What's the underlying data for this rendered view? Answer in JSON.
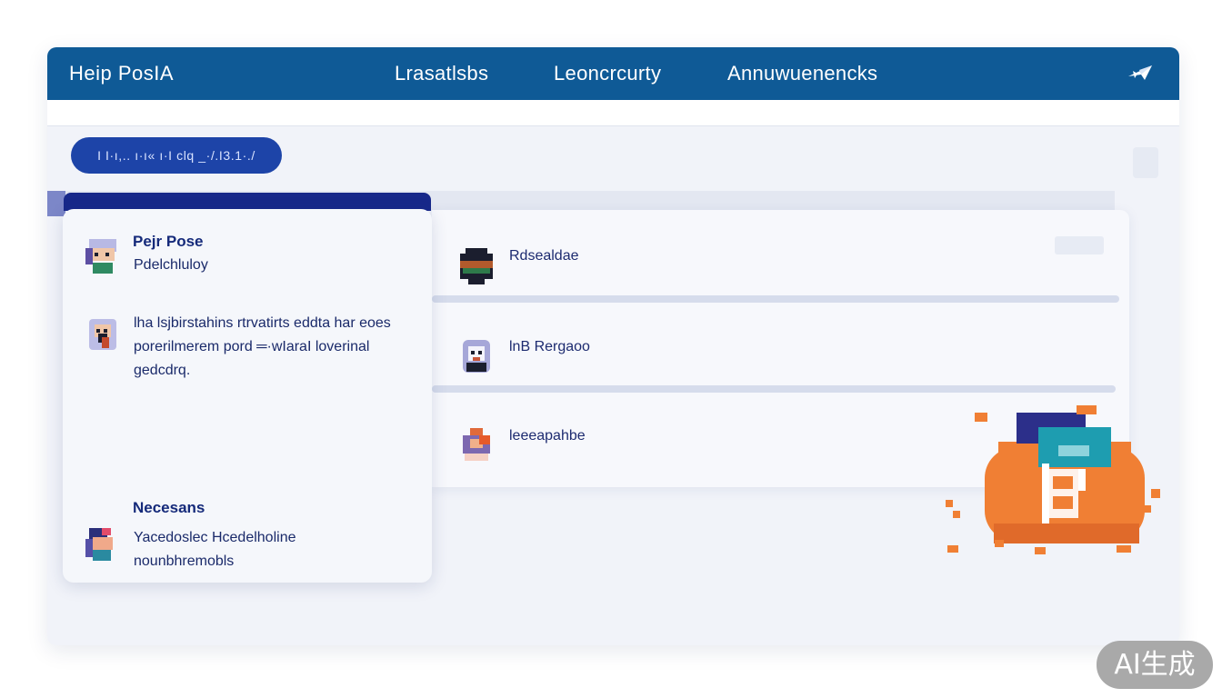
{
  "header": {
    "brand": "Heip PosIA",
    "nav": [
      {
        "label": "Lrasatlsbs"
      },
      {
        "label": "Leoncrcurty"
      },
      {
        "label": "Annuwuenencks"
      }
    ],
    "right_icon": "paper-plane-icon"
  },
  "toolbar": {
    "pill_label": "I I·ı,.. ı·ı« ı·I clq _·/.I3.1·./"
  },
  "left_panel": {
    "posts": [
      {
        "avatar_icon": "user-avatar-icon",
        "title": "Pejr Pose",
        "text": "Pdelchluloy"
      },
      {
        "avatar_icon": "user-avatar-icon",
        "title": "",
        "text": "lha lsjbirstahins rtrvatirts eddta har eoes porerilmerem pord ═·wIaraI loverinal gedcdrq."
      },
      {
        "avatar_icon": "user-avatar-icon",
        "title": "Necesans",
        "text": "Yacedoslec Hcedelholine nounbhremobls"
      }
    ]
  },
  "feed": {
    "items": [
      {
        "avatar_icon": "user-avatar-icon",
        "label": "Rdsealdae"
      },
      {
        "avatar_icon": "user-avatar-icon",
        "label": "lnB Rergaoo"
      },
      {
        "avatar_icon": "user-avatar-icon",
        "label": "leeeapahbe"
      }
    ]
  },
  "illustration": {
    "icon": "bitcoin-coin-icon"
  },
  "watermark": {
    "text": "AI生成"
  },
  "colors": {
    "topbar": "#0f5a96",
    "pill": "#1d44a8",
    "panel_head": "#17288a",
    "coin": "#f07f34",
    "coin_top": "#2c2f8a",
    "coin_teal": "#1e9db0"
  }
}
